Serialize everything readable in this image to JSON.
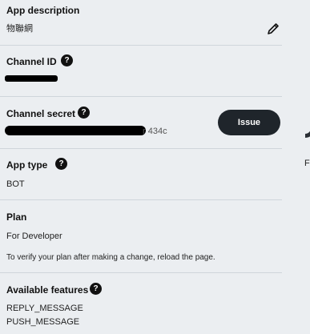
{
  "app_description": {
    "label": "App description",
    "value": "物聯網"
  },
  "channel_id": {
    "label": "Channel ID",
    "help": "?"
  },
  "channel_secret": {
    "label": "Channel secret",
    "help": "?",
    "tail": "r 434c",
    "issue_label": "Issue"
  },
  "app_type": {
    "label": "App type",
    "help": "?",
    "value": "BOT"
  },
  "plan": {
    "label": "Plan",
    "value": "For Developer",
    "note": "To verify your plan after making a change, reload the page."
  },
  "available_features": {
    "label": "Available features",
    "help": "?",
    "items": [
      "REPLY_MESSAGE",
      "PUSH_MESSAGE"
    ]
  },
  "right_panel": {
    "cut_text": "F"
  }
}
